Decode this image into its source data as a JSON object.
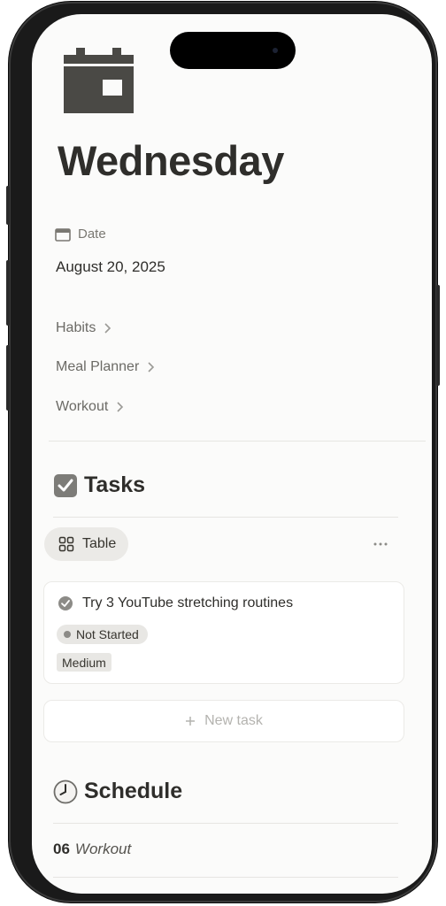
{
  "page": {
    "title": "Wednesday",
    "icon": "calendar-icon"
  },
  "properties": {
    "date_label": "Date",
    "date_icon": "calendar-icon",
    "date_value": "August 20, 2025"
  },
  "links": [
    {
      "label": "Habits"
    },
    {
      "label": "Meal Planner"
    },
    {
      "label": "Workout"
    }
  ],
  "tasks": {
    "heading": "Tasks",
    "heading_icon": "checkbox-checked-icon",
    "view_label": "Table",
    "view_icon": "grid-icon",
    "more_icon": "more-horizontal-icon",
    "items": [
      {
        "title": "Try 3 YouTube stretching routines",
        "status": "Not Started",
        "priority": "Medium"
      }
    ],
    "new_task_label": "New task",
    "new_task_icon": "plus-icon"
  },
  "schedule": {
    "heading": "Schedule",
    "heading_icon": "clock-icon",
    "items": [
      {
        "time": "06",
        "name": "Workout"
      }
    ]
  },
  "colors": {
    "background": "#fbfbfa",
    "text": "#2f2e2b",
    "muted": "#7a7872",
    "pill": "#e8e7e4",
    "icon_dark": "#4a4945"
  }
}
